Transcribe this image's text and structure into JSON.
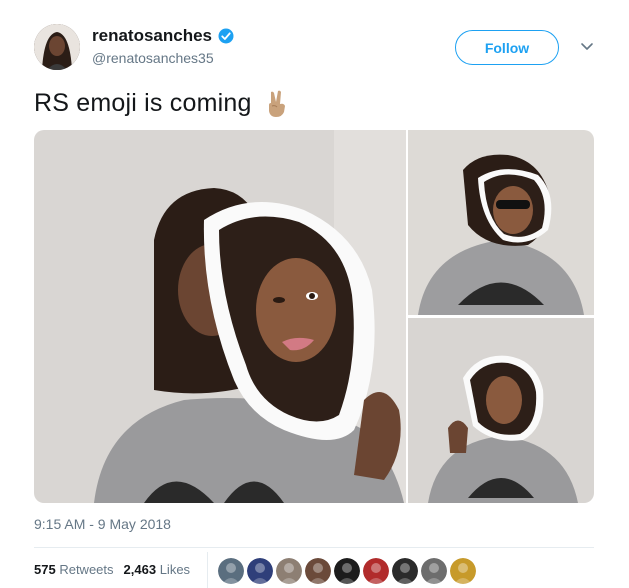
{
  "user": {
    "display_name": "renatosanches",
    "handle": "@renatosanches35",
    "verified": true
  },
  "follow_label": "Follow",
  "tweet": {
    "text": "RS emoji is coming",
    "emoji": "victory-hand"
  },
  "media": [
    {
      "name": "photo-main"
    },
    {
      "name": "photo-top-right"
    },
    {
      "name": "photo-bottom-right"
    }
  ],
  "timestamp": "9:15 AM - 9 May 2018",
  "stats": {
    "retweets_count": "575",
    "retweets_label": "Retweets",
    "likes_count": "2,463",
    "likes_label": "Likes"
  },
  "likers": [
    {
      "color": "#5a6e7f"
    },
    {
      "color": "#2f3f7a"
    },
    {
      "color": "#8d7f73"
    },
    {
      "color": "#6b4a3a"
    },
    {
      "color": "#1c1c1c"
    },
    {
      "color": "#b12b2b"
    },
    {
      "color": "#2b2b2b"
    },
    {
      "color": "#6d6d6d"
    },
    {
      "color": "#c79a2a"
    }
  ],
  "colors": {
    "accent": "#1da1f2",
    "secondary_text": "#657786",
    "primary_text": "#14171a"
  }
}
